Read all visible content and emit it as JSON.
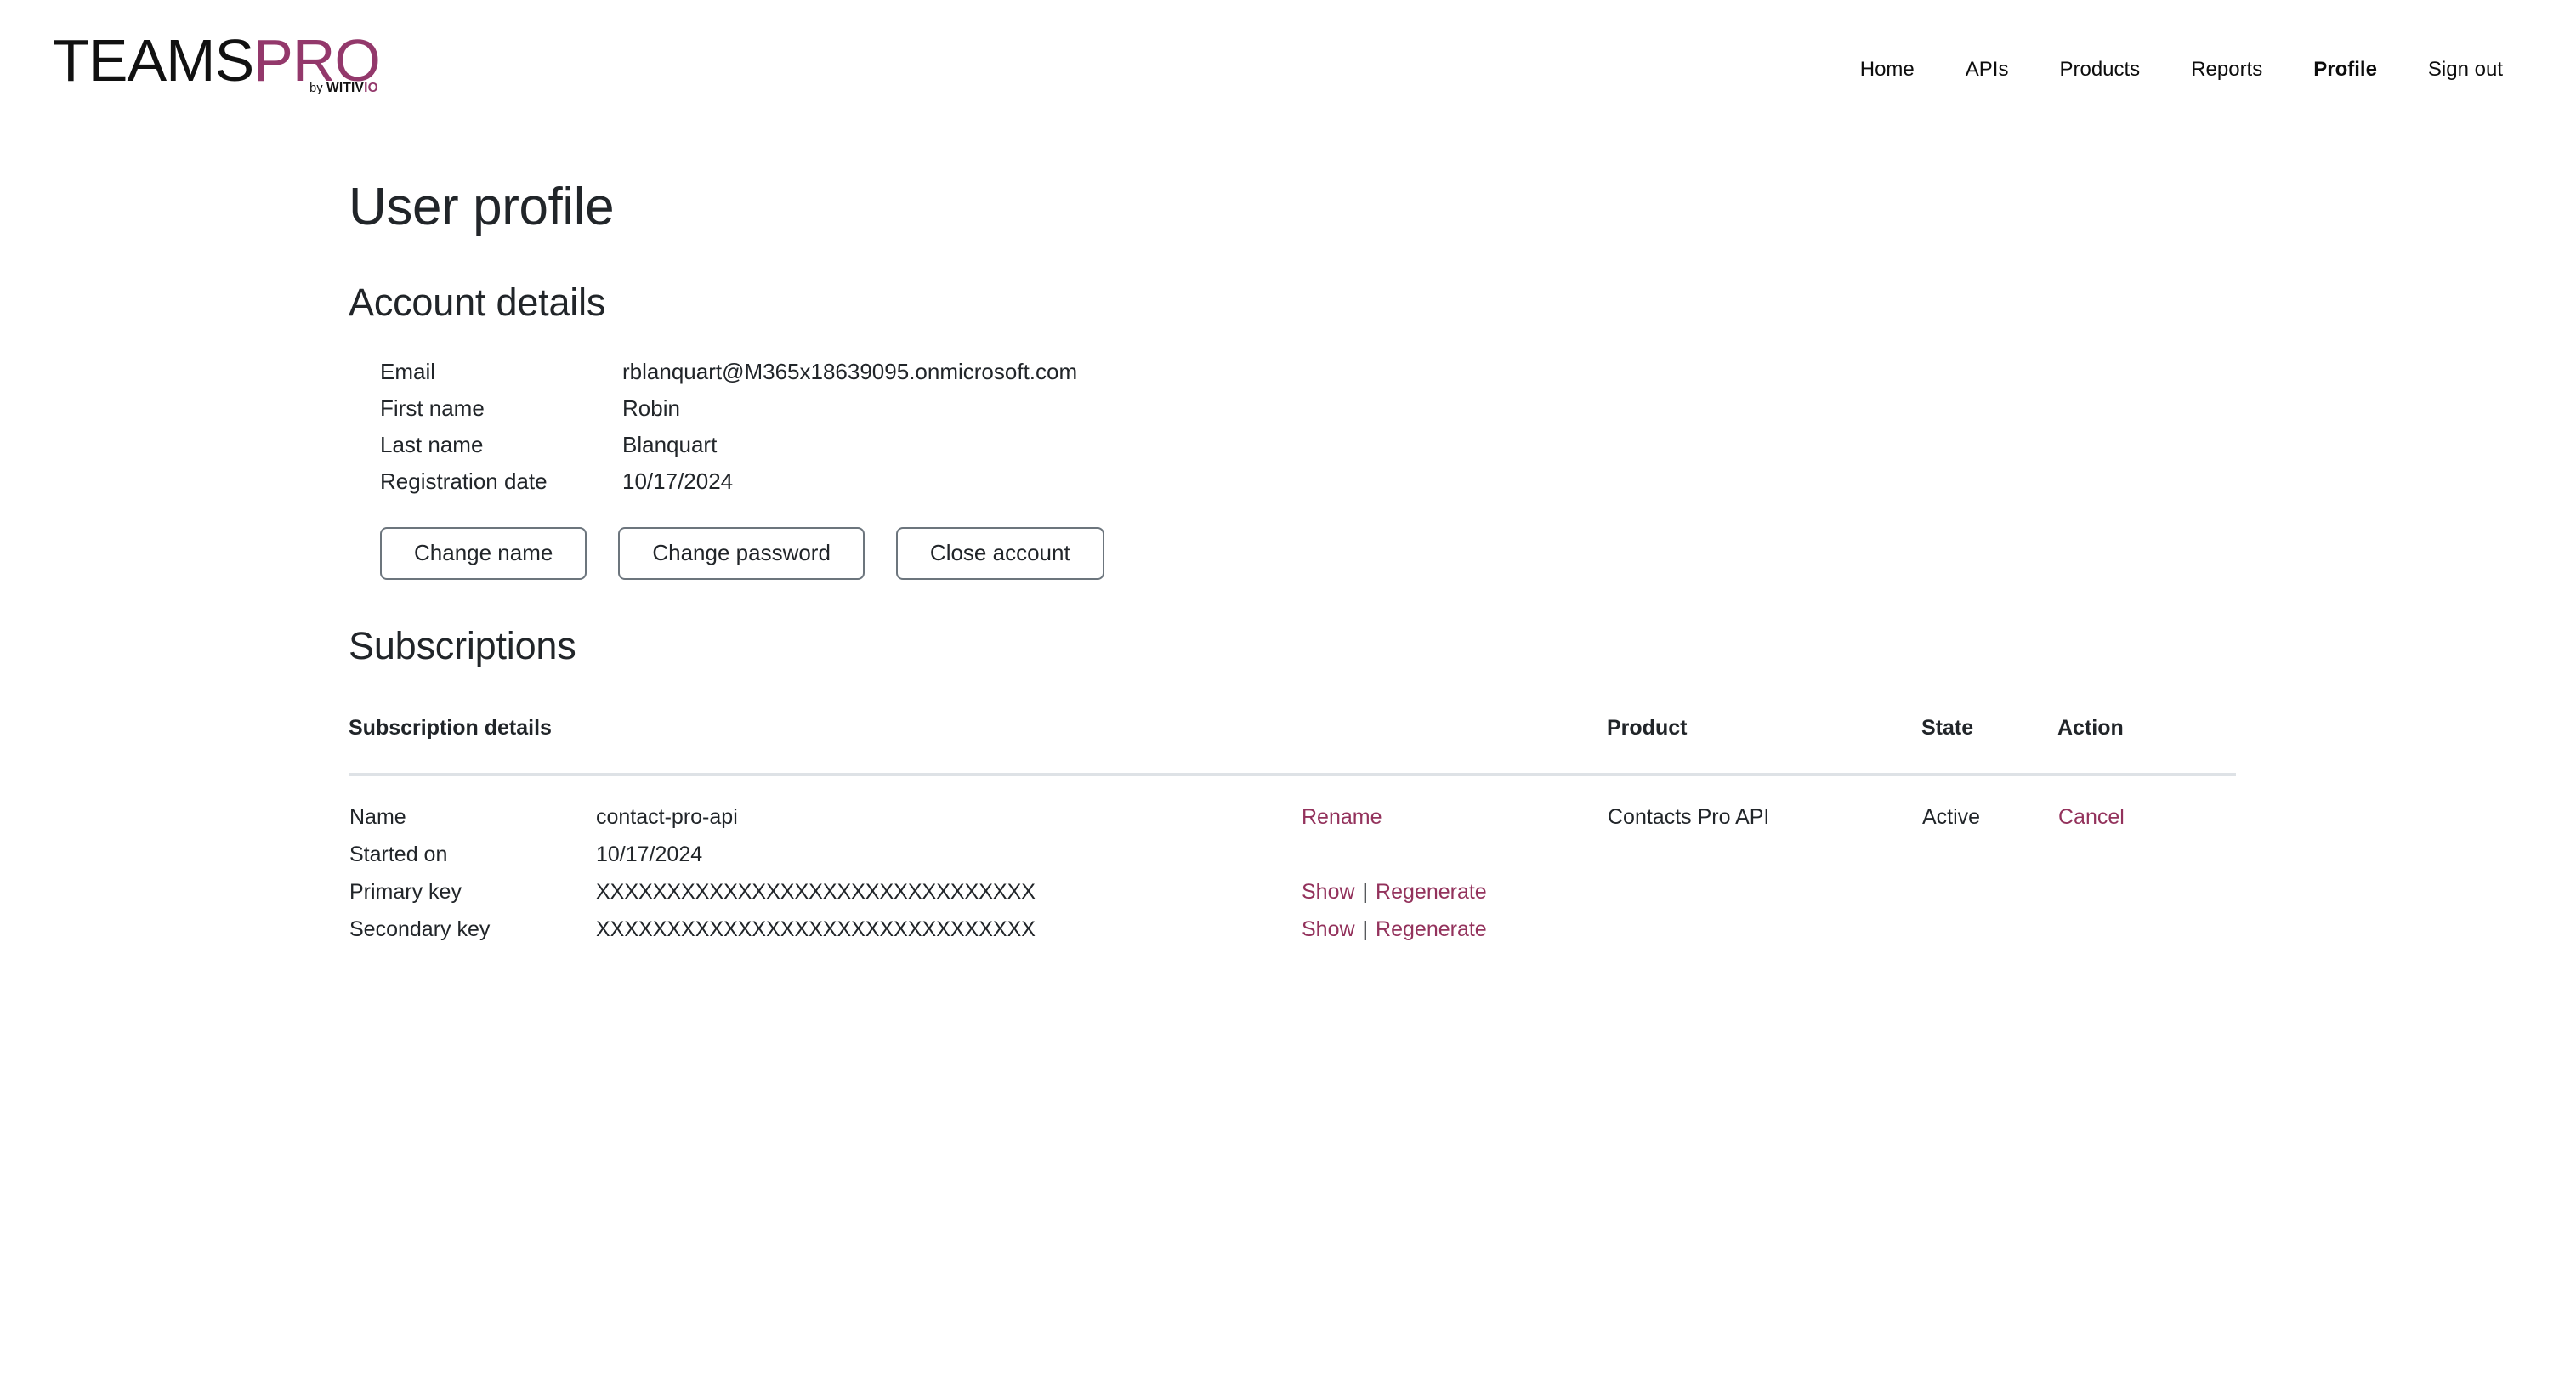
{
  "brand": {
    "word_dark": "TEAMS",
    "word_accent": "PRO",
    "tagline_by": "by ",
    "tagline_name": "WITIV",
    "tagline_accent": "IO",
    "accent_color": "#93386b"
  },
  "nav": {
    "items": [
      {
        "label": "Home",
        "active": false
      },
      {
        "label": "APIs",
        "active": false
      },
      {
        "label": "Products",
        "active": false
      },
      {
        "label": "Reports",
        "active": false
      },
      {
        "label": "Profile",
        "active": true
      },
      {
        "label": "Sign out",
        "active": false
      }
    ]
  },
  "page": {
    "title": "User profile"
  },
  "account": {
    "heading": "Account details",
    "fields": [
      {
        "label": "Email",
        "value": "rblanquart@M365x18639095.onmicrosoft.com"
      },
      {
        "label": "First name",
        "value": "Robin"
      },
      {
        "label": "Last name",
        "value": "Blanquart"
      },
      {
        "label": "Registration date",
        "value": "10/17/2024"
      }
    ],
    "buttons": [
      {
        "label": "Change name"
      },
      {
        "label": "Change password"
      },
      {
        "label": "Close account"
      }
    ]
  },
  "subscriptions": {
    "heading": "Subscriptions",
    "columns": {
      "details": "Subscription details",
      "links": "",
      "product": "Product",
      "state": "State",
      "action": "Action"
    },
    "rows": [
      {
        "lines": [
          {
            "label": "Name",
            "value": "contact-pro-api"
          },
          {
            "label": "Started on",
            "value": "10/17/2024"
          },
          {
            "label": "Primary key",
            "value": "XXXXXXXXXXXXXXXXXXXXXXXXXXXXXXX"
          },
          {
            "label": "Secondary key",
            "value": "XXXXXXXXXXXXXXXXXXXXXXXXXXXXXXX"
          }
        ],
        "link_lines": [
          {
            "primary": "Rename",
            "sep": "",
            "secondary": ""
          },
          {
            "primary": "",
            "sep": "",
            "secondary": ""
          },
          {
            "primary": "Show",
            "sep": "|",
            "secondary": "Regenerate"
          },
          {
            "primary": "Show",
            "sep": "|",
            "secondary": "Regenerate"
          }
        ],
        "product": "Contacts Pro API",
        "state": "Active",
        "action": "Cancel"
      }
    ]
  },
  "colors": {
    "link": "#93325c",
    "heading": "#212529",
    "border": "#dee2e6",
    "button_border": "#6c757d"
  }
}
